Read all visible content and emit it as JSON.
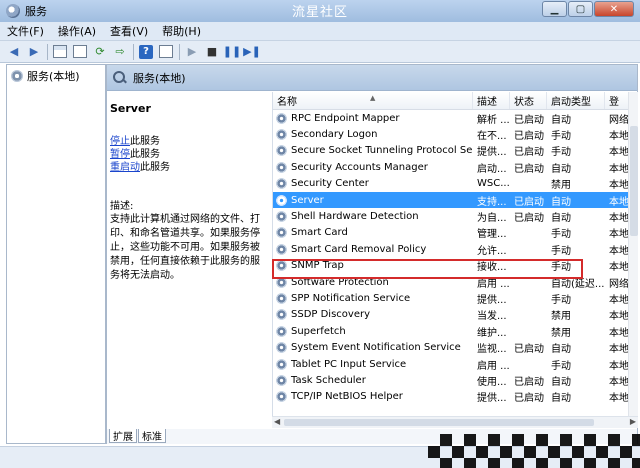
{
  "window": {
    "title": "服务",
    "watermark": "流星社区"
  },
  "menu": [
    "文件(F)",
    "操作(A)",
    "查看(V)",
    "帮助(H)"
  ],
  "tree": {
    "root": "服务(本地)"
  },
  "panel": {
    "title": "服务(本地)"
  },
  "desc": {
    "service_name": "Server",
    "stop_link": "停止",
    "stop_suffix": "此服务",
    "pause_link": "暂停",
    "pause_suffix": "此服务",
    "restart_link": "重启动",
    "restart_suffix": "此服务",
    "label": "描述:",
    "text": "支持此计算机通过网络的文件、打印、和命名管道共享。如果服务停止，这些功能不可用。如果服务被禁用，任何直接依赖于此服务的服务将无法启动。"
  },
  "columns": [
    "名称",
    "描述",
    "状态",
    "启动类型",
    "登"
  ],
  "rows": [
    {
      "name": "RPC Endpoint Mapper",
      "desc": "解析 ...",
      "status": "已启动",
      "start": "自动",
      "logon": "网络"
    },
    {
      "name": "Secondary Logon",
      "desc": "在不...",
      "status": "已启动",
      "start": "手动",
      "logon": "本地"
    },
    {
      "name": "Secure Socket Tunneling Protocol Ser...",
      "desc": "提供...",
      "status": "已启动",
      "start": "手动",
      "logon": "本地"
    },
    {
      "name": "Security Accounts Manager",
      "desc": "启动...",
      "status": "已启动",
      "start": "自动",
      "logon": "本地"
    },
    {
      "name": "Security Center",
      "desc": "WSC...",
      "status": "",
      "start": "禁用",
      "logon": "本地"
    },
    {
      "name": "Server",
      "desc": "支持...",
      "status": "已启动",
      "start": "自动",
      "logon": "本地",
      "selected": true
    },
    {
      "name": "Shell Hardware Detection",
      "desc": "为自...",
      "status": "已启动",
      "start": "自动",
      "logon": "本地"
    },
    {
      "name": "Smart Card",
      "desc": "管理...",
      "status": "",
      "start": "手动",
      "logon": "本地"
    },
    {
      "name": "Smart Card Removal Policy",
      "desc": "允许...",
      "status": "",
      "start": "手动",
      "logon": "本地"
    },
    {
      "name": "SNMP Trap",
      "desc": "接收...",
      "status": "",
      "start": "手动",
      "logon": "本地"
    },
    {
      "name": "Software Protection",
      "desc": "启用 ...",
      "status": "",
      "start": "自动(延迟...",
      "logon": "网络"
    },
    {
      "name": "SPP Notification Service",
      "desc": "提供...",
      "status": "",
      "start": "手动",
      "logon": "本地"
    },
    {
      "name": "SSDP Discovery",
      "desc": "当发...",
      "status": "",
      "start": "禁用",
      "logon": "本地"
    },
    {
      "name": "Superfetch",
      "desc": "维护...",
      "status": "",
      "start": "禁用",
      "logon": "本地"
    },
    {
      "name": "System Event Notification Service",
      "desc": "监视...",
      "status": "已启动",
      "start": "自动",
      "logon": "本地"
    },
    {
      "name": "Tablet PC Input Service",
      "desc": "启用 ...",
      "status": "",
      "start": "手动",
      "logon": "本地"
    },
    {
      "name": "Task Scheduler",
      "desc": "使用...",
      "status": "已启动",
      "start": "自动",
      "logon": "本地"
    },
    {
      "name": "TCP/IP NetBIOS Helper",
      "desc": "提供...",
      "status": "已启动",
      "start": "自动",
      "logon": "本地"
    }
  ],
  "tabs": [
    "扩展",
    "标准"
  ]
}
